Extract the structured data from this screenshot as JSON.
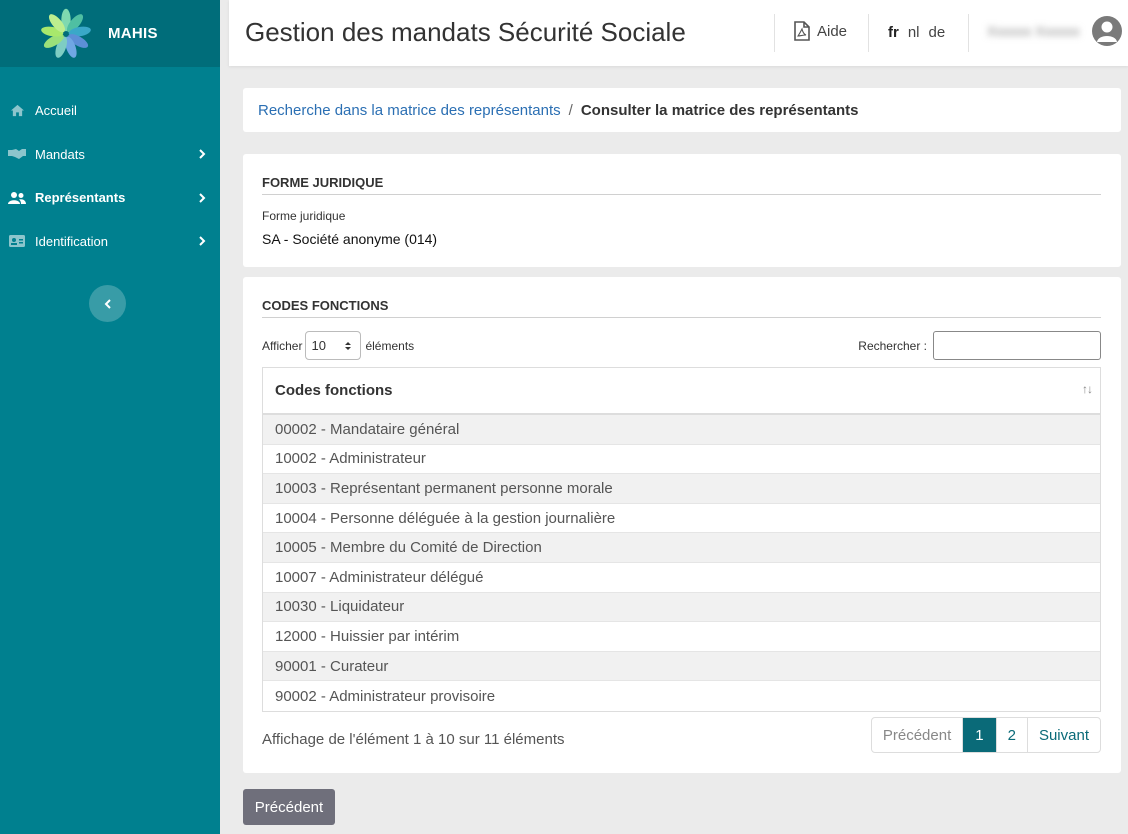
{
  "brand": {
    "name": "MAHIS"
  },
  "sidebar": {
    "items": [
      {
        "label": "Accueil",
        "icon": "home-icon"
      },
      {
        "label": "Mandats",
        "icon": "handshake-icon"
      },
      {
        "label": "Représentants",
        "icon": "users-icon"
      },
      {
        "label": "Identification",
        "icon": "id-card-icon"
      }
    ]
  },
  "header": {
    "title": "Gestion des mandats Sécurité Sociale",
    "help_label": "Aide",
    "languages": [
      "fr",
      "nl",
      "de"
    ],
    "current_language": "fr",
    "user_name": "Xxxxxx Xxxxxx"
  },
  "breadcrumb": {
    "parent": "Recherche dans la matrice des représentants",
    "separator": "/",
    "current": "Consulter la matrice des représentants"
  },
  "forme": {
    "section_title": "FORME JURIDIQUE",
    "field_label": "Forme juridique",
    "field_value": "SA - Société anonyme (014)"
  },
  "codes": {
    "section_title": "CODES FONCTIONS",
    "show_prefix": "Afficher",
    "page_size": "10",
    "show_suffix": "éléments",
    "search_label": "Rechercher :",
    "search_value": "",
    "column_header": "Codes fonctions",
    "rows": [
      "00002 - Mandataire général",
      "10002 - Administrateur",
      "10003 - Représentant permanent personne morale",
      "10004 - Personne déléguée à la gestion journalière",
      "10005 - Membre du Comité de Direction",
      "10007 - Administrateur délégué",
      "10030 - Liquidateur",
      "12000 - Huissier par intérim",
      "90001 - Curateur",
      "90002 - Administrateur provisoire"
    ],
    "info": "Affichage de l'élément 1 à 10 sur 11 éléments",
    "pagination": {
      "previous": "Précédent",
      "pages": [
        "1",
        "2"
      ],
      "current_page": "1",
      "next": "Suivant"
    }
  },
  "footer": {
    "back_label": "Précédent"
  },
  "colors": {
    "sidebar": "#00808f",
    "brand_bar": "#006d7a",
    "accent": "#0a6a78",
    "link": "#2b6fb3",
    "back_button": "#6f6f7b"
  }
}
